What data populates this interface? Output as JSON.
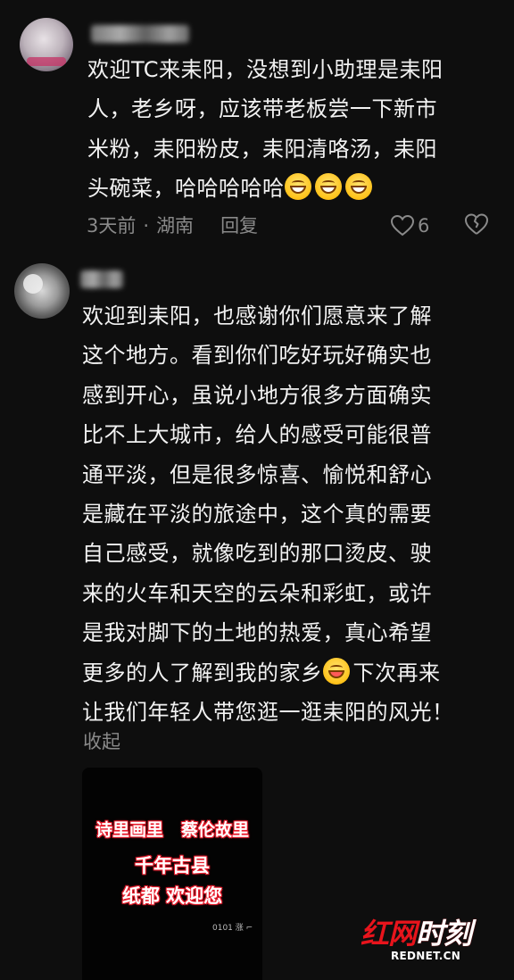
{
  "comments": [
    {
      "lines": [
        "欢迎TC来耒阳，没想到小助理是耒阳",
        "人，老乡呀，应该带老板尝一下新市",
        "米粉，耒阳粉皮，耒阳清咯汤，耒阳",
        "头碗菜，哈哈哈哈哈"
      ],
      "time": "3天前",
      "separator": "·",
      "location": "湖南",
      "reply_label": "回复",
      "like_count": "6"
    },
    {
      "lines": [
        "欢迎到耒阳，也感谢你们愿意来了解",
        "这个地方。看到你们吃好玩好确实也",
        "感到开心，虽说小地方很多方面确实",
        "比不上大城市，给人的感受可能很普",
        "通平淡，但是很多惊喜、愉悦和舒心",
        "是藏在平淡的旅途中，这个真的需要",
        "自己感受，就像吃到的那口烫皮、驶",
        "来的火车和天空的云朵和彩虹，或许",
        "是我对脚下的土地的热爱，真心希望",
        "更多的人了解到我的家乡",
        "下次再来",
        "让我们年轻人带您逛一逛耒阳的风光！"
      ],
      "collapse_label": "收起"
    }
  ],
  "video_card": {
    "line1_a": "诗里画里",
    "line1_b": "蔡伦故里",
    "line2": "千年古县",
    "line3": "纸都 欢迎您",
    "stamp": "0101 涨 ⌐"
  },
  "watermark": {
    "logo_a": "红网",
    "logo_b": "时刻",
    "site": "REDNET.CN"
  },
  "icons": {
    "grin_emoji": "grinning-face-emoji",
    "tongue_emoji": "winking-tongue-emoji",
    "like": "heart-outline-icon",
    "dislike": "broken-heart-icon"
  },
  "colors": {
    "background": "#0e0e0e",
    "text": "#f2f2f2",
    "meta": "#8a8a8a",
    "watermark_red": "#e8141c"
  }
}
